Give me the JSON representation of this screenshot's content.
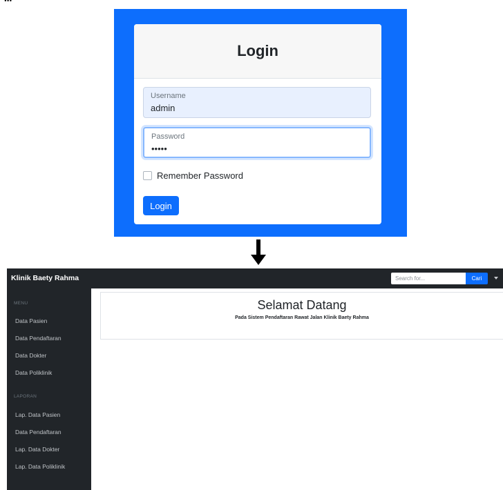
{
  "caption": "...",
  "login": {
    "title": "Login",
    "username_label": "Username",
    "username_value": "admin",
    "password_label": "Password",
    "password_value": "•••••",
    "remember_label": "Remember Password",
    "button_label": "Login"
  },
  "dashboard": {
    "brand": "Klinik Baety Rahma",
    "search_placeholder": "Search for...",
    "search_button": "Cari",
    "sidebar": {
      "menu_heading": "MENU",
      "menu_items": [
        {
          "label": "Data Pasien"
        },
        {
          "label": "Data Pendaftaran"
        },
        {
          "label": "Data Dokter"
        },
        {
          "label": "Data Poliklinik"
        }
      ],
      "report_heading": "LAPORAN",
      "report_items": [
        {
          "label": "Lap. Data Pasien"
        },
        {
          "label": "Data Pendaftaran"
        },
        {
          "label": "Lap. Data Dokter"
        },
        {
          "label": "Lap. Data Poliklinik"
        }
      ]
    },
    "welcome_title": "Selamat Datang",
    "welcome_subtitle": "Pada Sistem Pendaftaran Rawat Jalan Klinik Baety Rahma"
  },
  "colors": {
    "primary": "#0d6efd",
    "dark": "#212529"
  },
  "icons": {
    "arrow": "arrow-down-icon",
    "caret": "chevron-down-icon"
  }
}
